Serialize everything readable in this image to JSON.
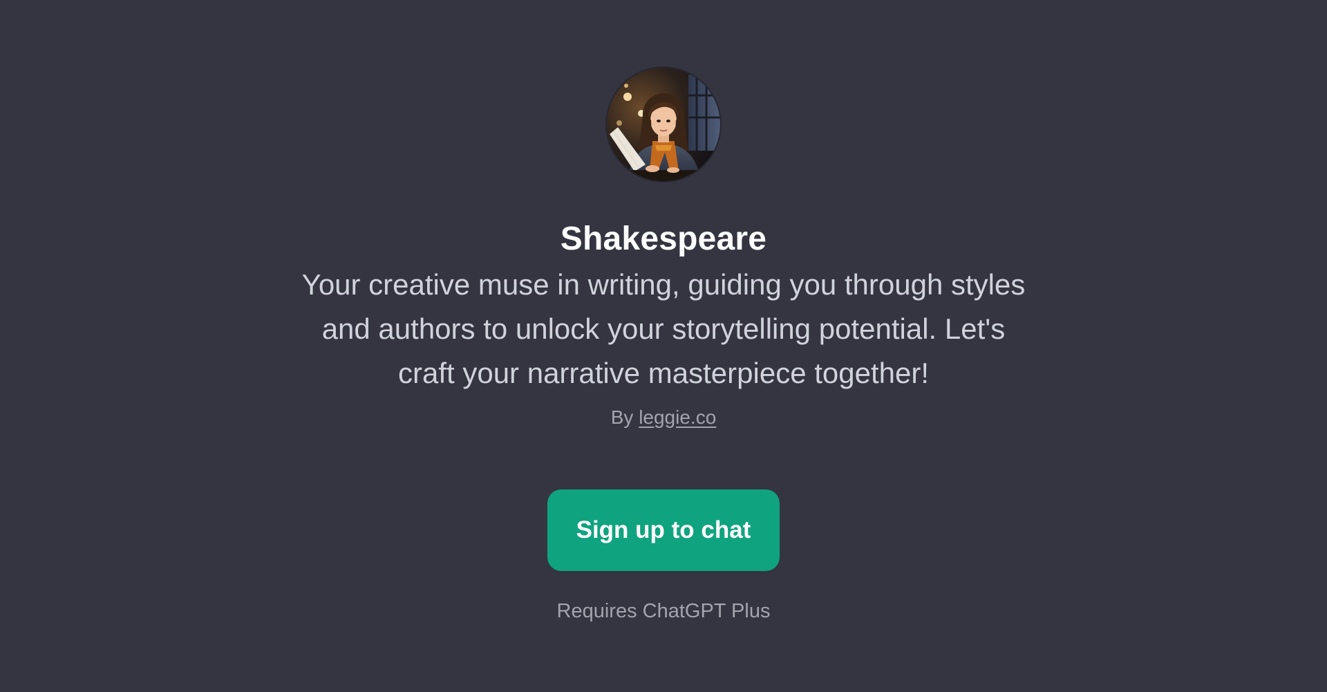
{
  "gpt": {
    "avatar_alt": "Shakespeare",
    "title": "Shakespeare",
    "description": "Your creative muse in writing, guiding you through styles and authors to unlock your storytelling potential. Let's craft your narrative masterpiece together!",
    "byline_prefix": "By",
    "author": "leggie.co"
  },
  "actions": {
    "signup_label": "Sign up to chat",
    "requirement": "Requires ChatGPT Plus"
  },
  "colors": {
    "background": "#343541",
    "title": "#ffffff",
    "description": "#d1d3dc",
    "muted": "#a3a4ad",
    "accent": "#10a37f"
  }
}
